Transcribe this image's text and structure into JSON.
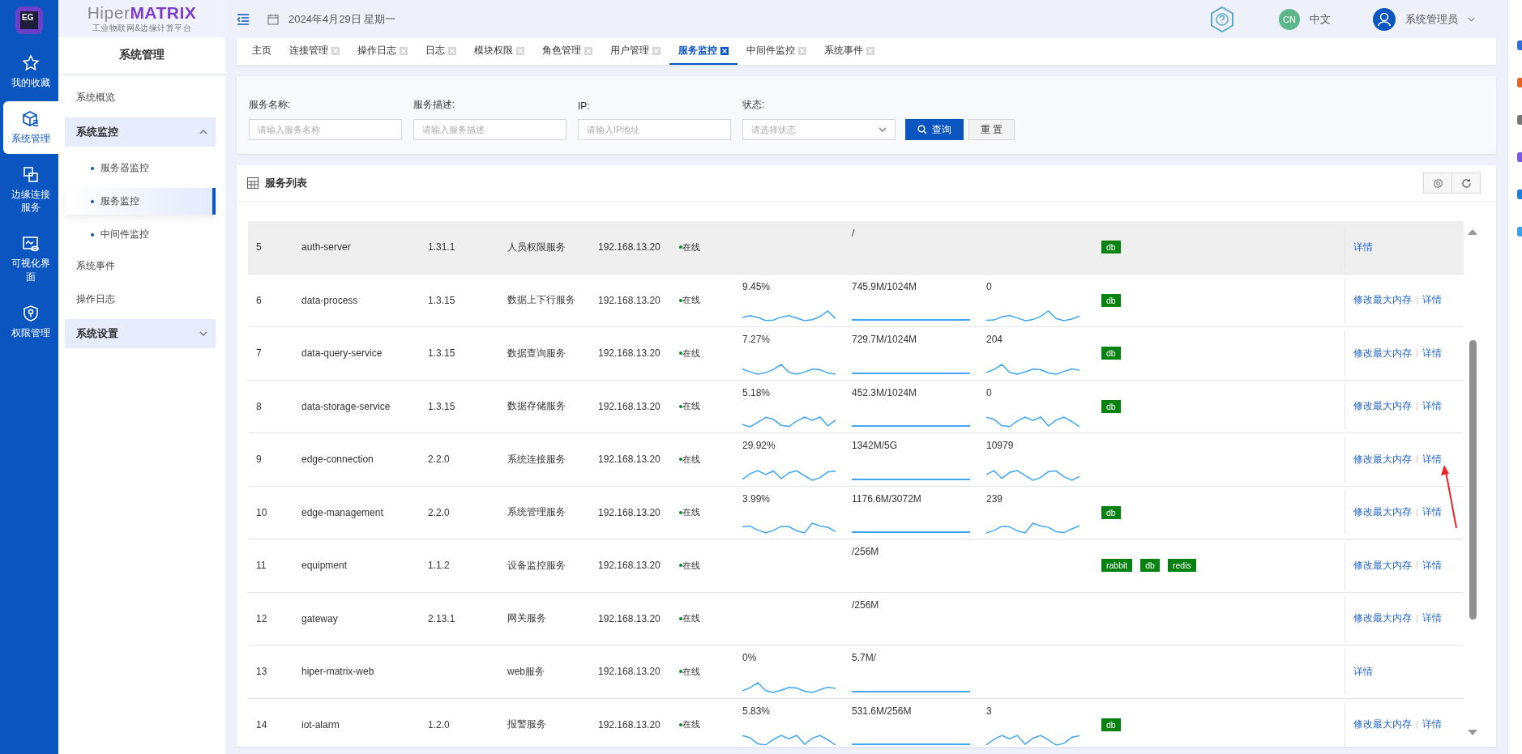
{
  "nav": {
    "logo": "EG",
    "items": [
      {
        "label": "我的收藏",
        "selected": false
      },
      {
        "label": "系统管理",
        "selected": true
      },
      {
        "label": "边缘连接服务",
        "selected": false
      },
      {
        "label": "可视化界面",
        "selected": false
      },
      {
        "label": "权限管理",
        "selected": false
      }
    ]
  },
  "brand": {
    "prefix": "Hiper",
    "suffix": "MATRIX",
    "tagline": "工业物联网&边缘计算平台"
  },
  "sidebar": {
    "title": "系统管理",
    "items": [
      {
        "label": "系统概览",
        "kind": "item",
        "selected": false
      },
      {
        "label": "系统监控",
        "kind": "group",
        "expanded": true,
        "children": [
          {
            "label": "服务器监控",
            "selected": false
          },
          {
            "label": "服务监控",
            "selected": true
          },
          {
            "label": "中间件监控",
            "selected": false
          }
        ]
      },
      {
        "label": "系统事件",
        "kind": "item",
        "selected": false
      },
      {
        "label": "操作日志",
        "kind": "item",
        "selected": false
      },
      {
        "label": "系统设置",
        "kind": "group",
        "expanded": false
      }
    ]
  },
  "header": {
    "date": "2024年4月29日 星期一",
    "language_badge": "CN",
    "language": "中文",
    "user": "系统管理员"
  },
  "tabs": [
    {
      "label": "主页",
      "closable": false,
      "selected": false
    },
    {
      "label": "连接管理",
      "closable": true,
      "selected": false
    },
    {
      "label": "操作日志",
      "closable": true,
      "selected": false
    },
    {
      "label": "日志",
      "closable": true,
      "selected": false
    },
    {
      "label": "模块权限",
      "closable": true,
      "selected": false
    },
    {
      "label": "角色管理",
      "closable": true,
      "selected": false
    },
    {
      "label": "用户管理",
      "closable": true,
      "selected": false
    },
    {
      "label": "服务监控",
      "closable": true,
      "selected": true
    },
    {
      "label": "中间件监控",
      "closable": true,
      "selected": false
    },
    {
      "label": "系统事件",
      "closable": true,
      "selected": false
    }
  ],
  "filters": [
    {
      "label": "服务名称:",
      "placeholder": "请输入服务名称",
      "kind": "input"
    },
    {
      "label": "服务描述:",
      "placeholder": "请输入服务描述",
      "kind": "input"
    },
    {
      "label": "IP:",
      "placeholder": "请输入IP地址",
      "kind": "input"
    },
    {
      "label": "状态:",
      "placeholder": "请选择状态",
      "kind": "select"
    }
  ],
  "filter_buttons": [
    {
      "label": "查询",
      "kind": "primary"
    },
    {
      "label": "重 置",
      "kind": "default"
    }
  ],
  "table": {
    "title": "服务列表",
    "rows": [
      {
        "index": "5",
        "name": "auth-server",
        "version": "1.31.1",
        "description": "人员权限服务",
        "ip": "192.168.13.20",
        "status": "在线",
        "cpu": null,
        "memory": {
          "value": "/",
          "line": false
        },
        "connections": null,
        "tags": [
          "db"
        ],
        "actions": [
          "详情"
        ],
        "selected": true
      },
      {
        "index": "6",
        "name": "data-process",
        "version": "1.3.15",
        "description": "数据上下行服务",
        "ip": "192.168.13.20",
        "status": "在线",
        "cpu": "9.45%",
        "memory": {
          "value": "745.9M/1024M",
          "line": true
        },
        "connections": "0",
        "tags": [
          "db"
        ],
        "actions": [
          "修改最大内存",
          "详情"
        ],
        "selected": false
      },
      {
        "index": "7",
        "name": "data-query-service",
        "version": "1.3.15",
        "description": "数据查询服务",
        "ip": "192.168.13.20",
        "status": "在线",
        "cpu": "7.27%",
        "memory": {
          "value": "729.7M/1024M",
          "line": true
        },
        "connections": "204",
        "tags": [
          "db"
        ],
        "actions": [
          "修改最大内存",
          "详情"
        ],
        "selected": false
      },
      {
        "index": "8",
        "name": "data-storage-service",
        "version": "1.3.15",
        "description": "数据存储服务",
        "ip": "192.168.13.20",
        "status": "在线",
        "cpu": "5.18%",
        "memory": {
          "value": "452.3M/1024M",
          "line": true
        },
        "connections": "0",
        "tags": [
          "db"
        ],
        "actions": [
          "修改最大内存",
          "详情"
        ],
        "selected": false
      },
      {
        "index": "9",
        "name": "edge-connection",
        "version": "2.2.0",
        "description": "系统连接服务",
        "ip": "192.168.13.20",
        "status": "在线",
        "cpu": "29.92%",
        "memory": {
          "value": "1342M/5G",
          "line": true
        },
        "connections": "10979",
        "tags": [],
        "actions": [
          "修改最大内存",
          "详情"
        ],
        "selected": false
      },
      {
        "index": "10",
        "name": "edge-management",
        "version": "2.2.0",
        "description": "系统管理服务",
        "ip": "192.168.13.20",
        "status": "在线",
        "cpu": "3.99%",
        "memory": {
          "value": "1176.6M/3072M",
          "line": true
        },
        "connections": "239",
        "tags": [
          "db"
        ],
        "actions": [
          "修改最大内存",
          "详情"
        ],
        "selected": false
      },
      {
        "index": "11",
        "name": "equipment",
        "version": "1.1.2",
        "description": "设备监控服务",
        "ip": "192.168.13.20",
        "status": "在线",
        "cpu": null,
        "memory": {
          "value": "/256M",
          "line": false
        },
        "connections": null,
        "tags": [
          "rabbit",
          "db",
          "redis"
        ],
        "actions": [
          "修改最大内存",
          "详情"
        ],
        "selected": false
      },
      {
        "index": "12",
        "name": "gateway",
        "version": "2.13.1",
        "description": "网关服务",
        "ip": "192.168.13.20",
        "status": "在线",
        "cpu": null,
        "memory": {
          "value": "/256M",
          "line": false
        },
        "connections": null,
        "tags": [],
        "actions": [
          "修改最大内存",
          "详情"
        ],
        "selected": false
      },
      {
        "index": "13",
        "name": "hiper-matrix-web",
        "version": null,
        "description": "web服务",
        "ip": "192.168.13.20",
        "status": "在线",
        "cpu": "0%",
        "memory": {
          "value": "5.7M/",
          "line": true
        },
        "connections": null,
        "tags": [],
        "actions": [
          "详情"
        ],
        "selected": false
      },
      {
        "index": "14",
        "name": "iot-alarm",
        "version": "1.2.0",
        "description": "报警服务",
        "ip": "192.168.13.20",
        "status": "在线",
        "cpu": "5.83%",
        "memory": {
          "value": "531.6M/256M",
          "line": true
        },
        "connections": "3",
        "tags": [
          "db"
        ],
        "actions": [
          "修改最大内存",
          "详情"
        ],
        "selected": false
      }
    ]
  }
}
